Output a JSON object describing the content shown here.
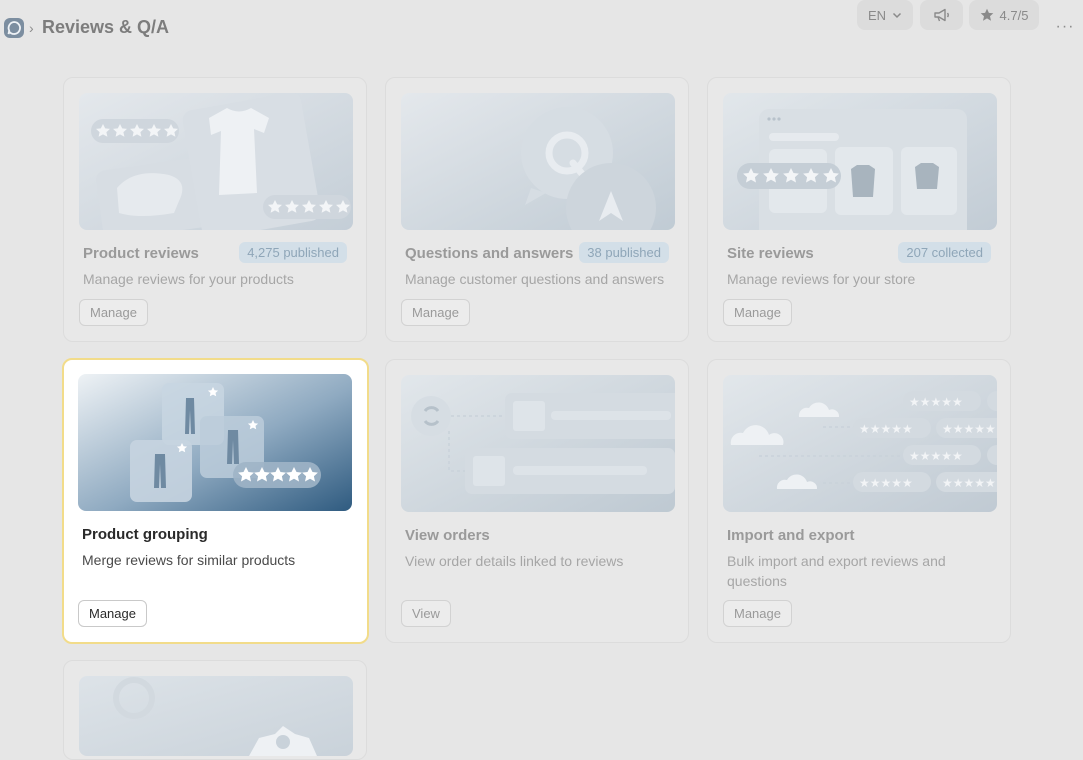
{
  "header": {
    "title": "Reviews & Q/A",
    "language": "EN",
    "rating": "4.7/5",
    "icons": {
      "logo": "chat-bubble-logo",
      "chevron": "chevron-down-icon",
      "announce": "megaphone-icon",
      "star": "star-icon",
      "more": "more-horizontal-icon"
    }
  },
  "cards": [
    {
      "title": "Product reviews",
      "badge": "4,275 published",
      "description": "Manage reviews for your products",
      "button": "Manage"
    },
    {
      "title": "Questions and answers",
      "badge": "38 published",
      "description": "Manage customer questions and answers",
      "button": "Manage"
    },
    {
      "title": "Site reviews",
      "badge": "207 collected",
      "description": "Manage reviews for your store",
      "button": "Manage"
    },
    {
      "title": "Product grouping",
      "description": "Merge reviews for similar products",
      "button": "Manage"
    },
    {
      "title": "View orders",
      "description": "View order details linked to reviews",
      "button": "View"
    },
    {
      "title": "Import and export",
      "description": "Bulk import and export reviews and questions",
      "button": "Manage"
    }
  ],
  "colors": {
    "background": "#e6e6e6",
    "active_border": "#f2dc8a",
    "badge_bg": "#d3dfe8",
    "badge_text": "#8fa6b8",
    "thumb_active": "#3b6384"
  }
}
